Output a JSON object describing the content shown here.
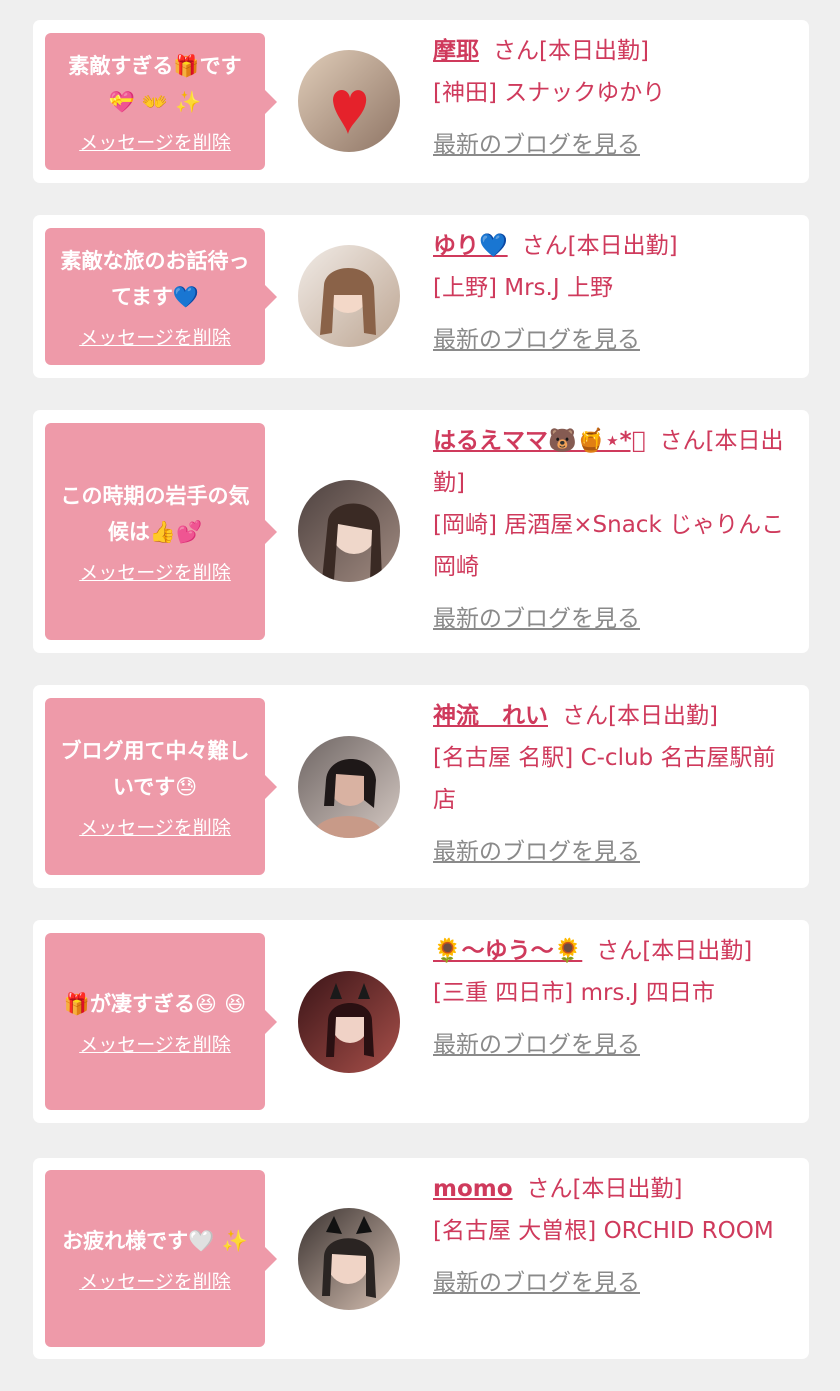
{
  "messages": [
    {
      "message": "素敵すぎる🎁です 💝 👐 ✨",
      "delete_label": "メッセージを削除",
      "name": "摩耶",
      "honorific": "さん[本日出勤]",
      "shop": "[神田] スナックゆかり",
      "blog_label": "最新のブログを見る",
      "avatar_colors": [
        "#d9c3ad",
        "#9d7e6b"
      ]
    },
    {
      "message": "素敵な旅のお話待ってます💙",
      "delete_label": "メッセージを削除",
      "name": "ゆり💙",
      "honorific": "さん[本日出勤]",
      "shop": "[上野] Mrs.J 上野",
      "blog_label": "最新のブログを見る",
      "avatar_colors": [
        "#e8e0da",
        "#c4b1a0"
      ]
    },
    {
      "message": "この時期の岩手の気候は👍💕",
      "delete_label": "メッセージを削除",
      "name": "はるえママ🐻🍯⋆*ﾟ",
      "honorific": "さん[本日出勤]",
      "shop": "[岡崎] 居酒屋×Snack じゃりんこ岡崎",
      "blog_label": "最新のブログを見る",
      "avatar_colors": [
        "#5a4c46",
        "#d7bfb0"
      ]
    },
    {
      "message": "ブログ用て中々難しいです😓",
      "delete_label": "メッセージを削除",
      "name": "神流　れい",
      "honorific": "さん[本日出勤]",
      "shop": "[名古屋 名駅] C-club 名古屋駅前店",
      "blog_label": "最新のブログを見る",
      "avatar_colors": [
        "#3a3030",
        "#caa494"
      ]
    },
    {
      "message": "🎁が凄すぎる😆 😆",
      "delete_label": "メッセージを削除",
      "name": "🌻〜ゆう〜🌻",
      "honorific": "さん[本日出勤]",
      "shop": "[三重 四日市] mrs.J 四日市",
      "blog_label": "最新のブログを見る",
      "avatar_colors": [
        "#4a1a1f",
        "#b55a52"
      ]
    },
    {
      "message": "お疲れ様です🤍 ✨",
      "delete_label": "メッセージを削除",
      "name": "momo",
      "honorific": "さん[本日出勤]",
      "shop": "[名古屋 大曽根] ORCHID ROOM",
      "blog_label": "最新のブログを見る",
      "avatar_colors": [
        "#2b2624",
        "#dcc4b4"
      ]
    }
  ]
}
